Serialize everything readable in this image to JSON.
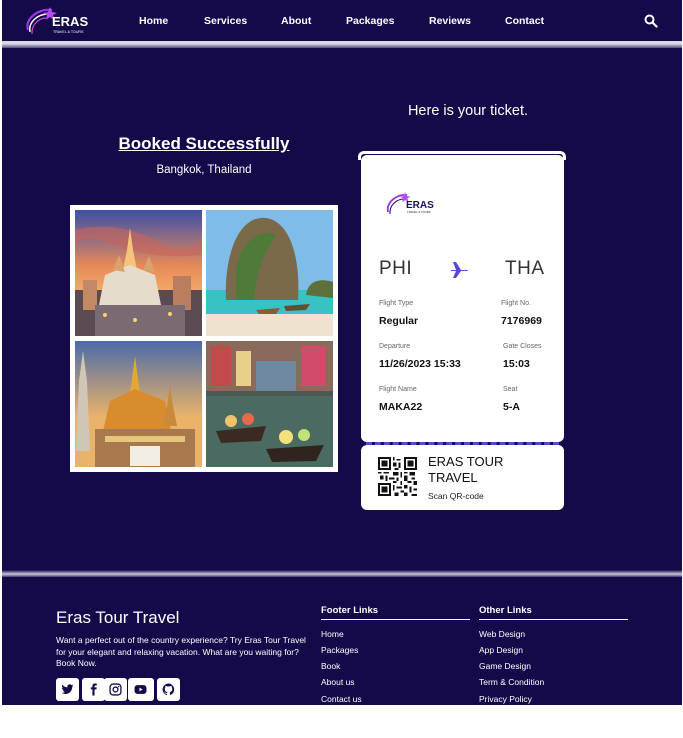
{
  "nav": {
    "items": [
      "Home",
      "Services",
      "About",
      "Packages",
      "Reviews",
      "Contact"
    ],
    "logo_text": "ERAS",
    "logo_subtext": "TRAVEL & TOURS"
  },
  "booking": {
    "title": "Booked Successfully",
    "location": "Bangkok, Thailand"
  },
  "ticket": {
    "heading": "Here is your ticket.",
    "from": "PHI",
    "to": "THA",
    "fields": {
      "flight_type": {
        "label": "Flight Type",
        "value": "Regular"
      },
      "flight_no": {
        "label": "Flight No.",
        "value": "7176969"
      },
      "departure": {
        "label": "Departure",
        "value": "11/26/2023 15:33"
      },
      "gate_closes": {
        "label": "Gate Closes",
        "value": "15:03"
      },
      "flight_name": {
        "label": "Flight Name",
        "value": "MAKA22"
      },
      "seat": {
        "label": "Seat",
        "value": "5-A"
      }
    },
    "stub_title": "ERAS TOUR TRAVEL",
    "stub_sub": "Scan QR-code"
  },
  "footer": {
    "brand": "Eras Tour Travel",
    "description": "Want a perfect out of the country experience? Try Eras Tour Travel for your elegant and relaxing vacation. What are you waiting for? Book Now.",
    "footer_links_heading": "Footer Links",
    "footer_links": [
      "Home",
      "Packages",
      "Book",
      "About us",
      "Contact us"
    ],
    "other_links_heading": "Other Links",
    "other_links": [
      "Web Design",
      "App Design",
      "Game Design",
      "Term & Condition",
      "Privacy Policy"
    ]
  },
  "colors": {
    "background": "#140a4a",
    "accent": "#5548d6",
    "logo_purple": "#9b35e8"
  }
}
